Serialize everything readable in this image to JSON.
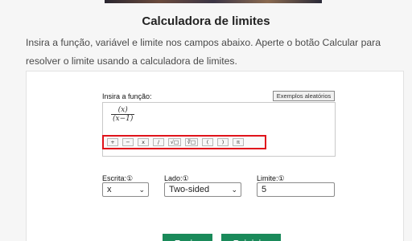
{
  "page": {
    "title": "Calculadora de limites",
    "intro": "Insira a função, variável e limite nos campos abaixo. Aperte o botão Calcular para resolver o limite usando a calculadora de limites."
  },
  "calculator": {
    "function_label": "Insira a função:",
    "examples_button": "Exemplos aleatórios",
    "fraction": {
      "numerator": "(x)",
      "denominator": "(x−1)"
    },
    "toolbar": [
      "+",
      "−",
      "x",
      "/",
      "√□",
      "∛□",
      "(",
      ")",
      "π"
    ],
    "variable_label": "Escrita:①",
    "variable_value": "x",
    "side_label": "Lado:①",
    "side_value": "Two-sided",
    "limit_label": "Limite:①",
    "limit_value": "5",
    "submit_button": "Enviar",
    "reset_button": "Reiniciar"
  },
  "colors": {
    "accent": "#1a8a5a",
    "highlight": "#e0131b"
  }
}
